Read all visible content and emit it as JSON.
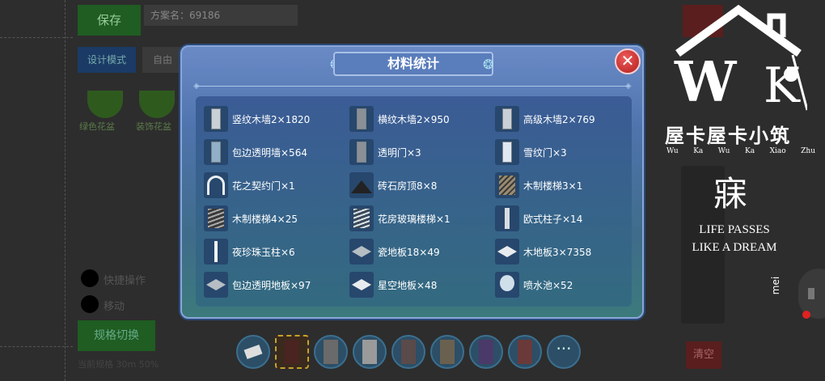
{
  "background": {
    "save_label": "保存",
    "scheme_label": "方案名：69186",
    "design_mode_label": "设计模式",
    "free_mode_label": "自由",
    "left_items": [
      "绿色花盆",
      "装饰花盆"
    ],
    "options": [
      "快捷操作",
      "移动"
    ],
    "switch_label": "规格切换",
    "tip_text": "当前规格 30m 50%",
    "clear_label": "清空",
    "side_text": "mei"
  },
  "watermark": {
    "name_cn": "屋卡屋卡小筑",
    "pinyin": [
      "Wu",
      "Ka",
      "Wu",
      "Ka",
      "Xiao",
      "Zhu"
    ],
    "seal": "寐",
    "motto_line1": "LIFE PASSES",
    "motto_line2": "LIKE A DREAM"
  },
  "modal": {
    "title": "材料统计",
    "close_symbol": "✕",
    "items": [
      {
        "label": "竖纹木墙2×1820",
        "icon": "wall-panel-icon"
      },
      {
        "label": "横纹木墙2×950",
        "icon": "wall-panel-icon"
      },
      {
        "label": "高级木墙2×769",
        "icon": "wall-panel-icon"
      },
      {
        "label": "包边透明墙×564",
        "icon": "glass-wall-icon"
      },
      {
        "label": "透明门×3",
        "icon": "glass-door-icon"
      },
      {
        "label": "雪纹门×3",
        "icon": "snow-door-icon"
      },
      {
        "label": "花之契约门×1",
        "icon": "flower-arch-icon"
      },
      {
        "label": "砖石房顶8×8",
        "icon": "roof-icon"
      },
      {
        "label": "木制楼梯3×1",
        "icon": "stairs-icon"
      },
      {
        "label": "木制楼梯4×25",
        "icon": "spiral-stairs-icon"
      },
      {
        "label": "花房玻璃楼梯×1",
        "icon": "glass-stairs-icon"
      },
      {
        "label": "欧式柱子×14",
        "icon": "column-icon"
      },
      {
        "label": "夜珍珠玉柱×6",
        "icon": "pearl-pillar-icon"
      },
      {
        "label": "瓷地板18×49",
        "icon": "tile-floor-icon"
      },
      {
        "label": "木地板3×7358",
        "icon": "wood-floor-icon"
      },
      {
        "label": "包边透明地板×97",
        "icon": "glass-floor-icon"
      },
      {
        "label": "星空地板×48",
        "icon": "star-floor-icon"
      },
      {
        "label": "喷水池×52",
        "icon": "fountain-icon"
      }
    ]
  },
  "toolbar": {
    "tools": [
      "eraser-icon",
      "door-dark-icon",
      "door-grey-icon",
      "door-silver-icon",
      "door-teal-icon",
      "window-icon",
      "window-purple-icon",
      "window-red-icon"
    ],
    "more_label": "···"
  }
}
